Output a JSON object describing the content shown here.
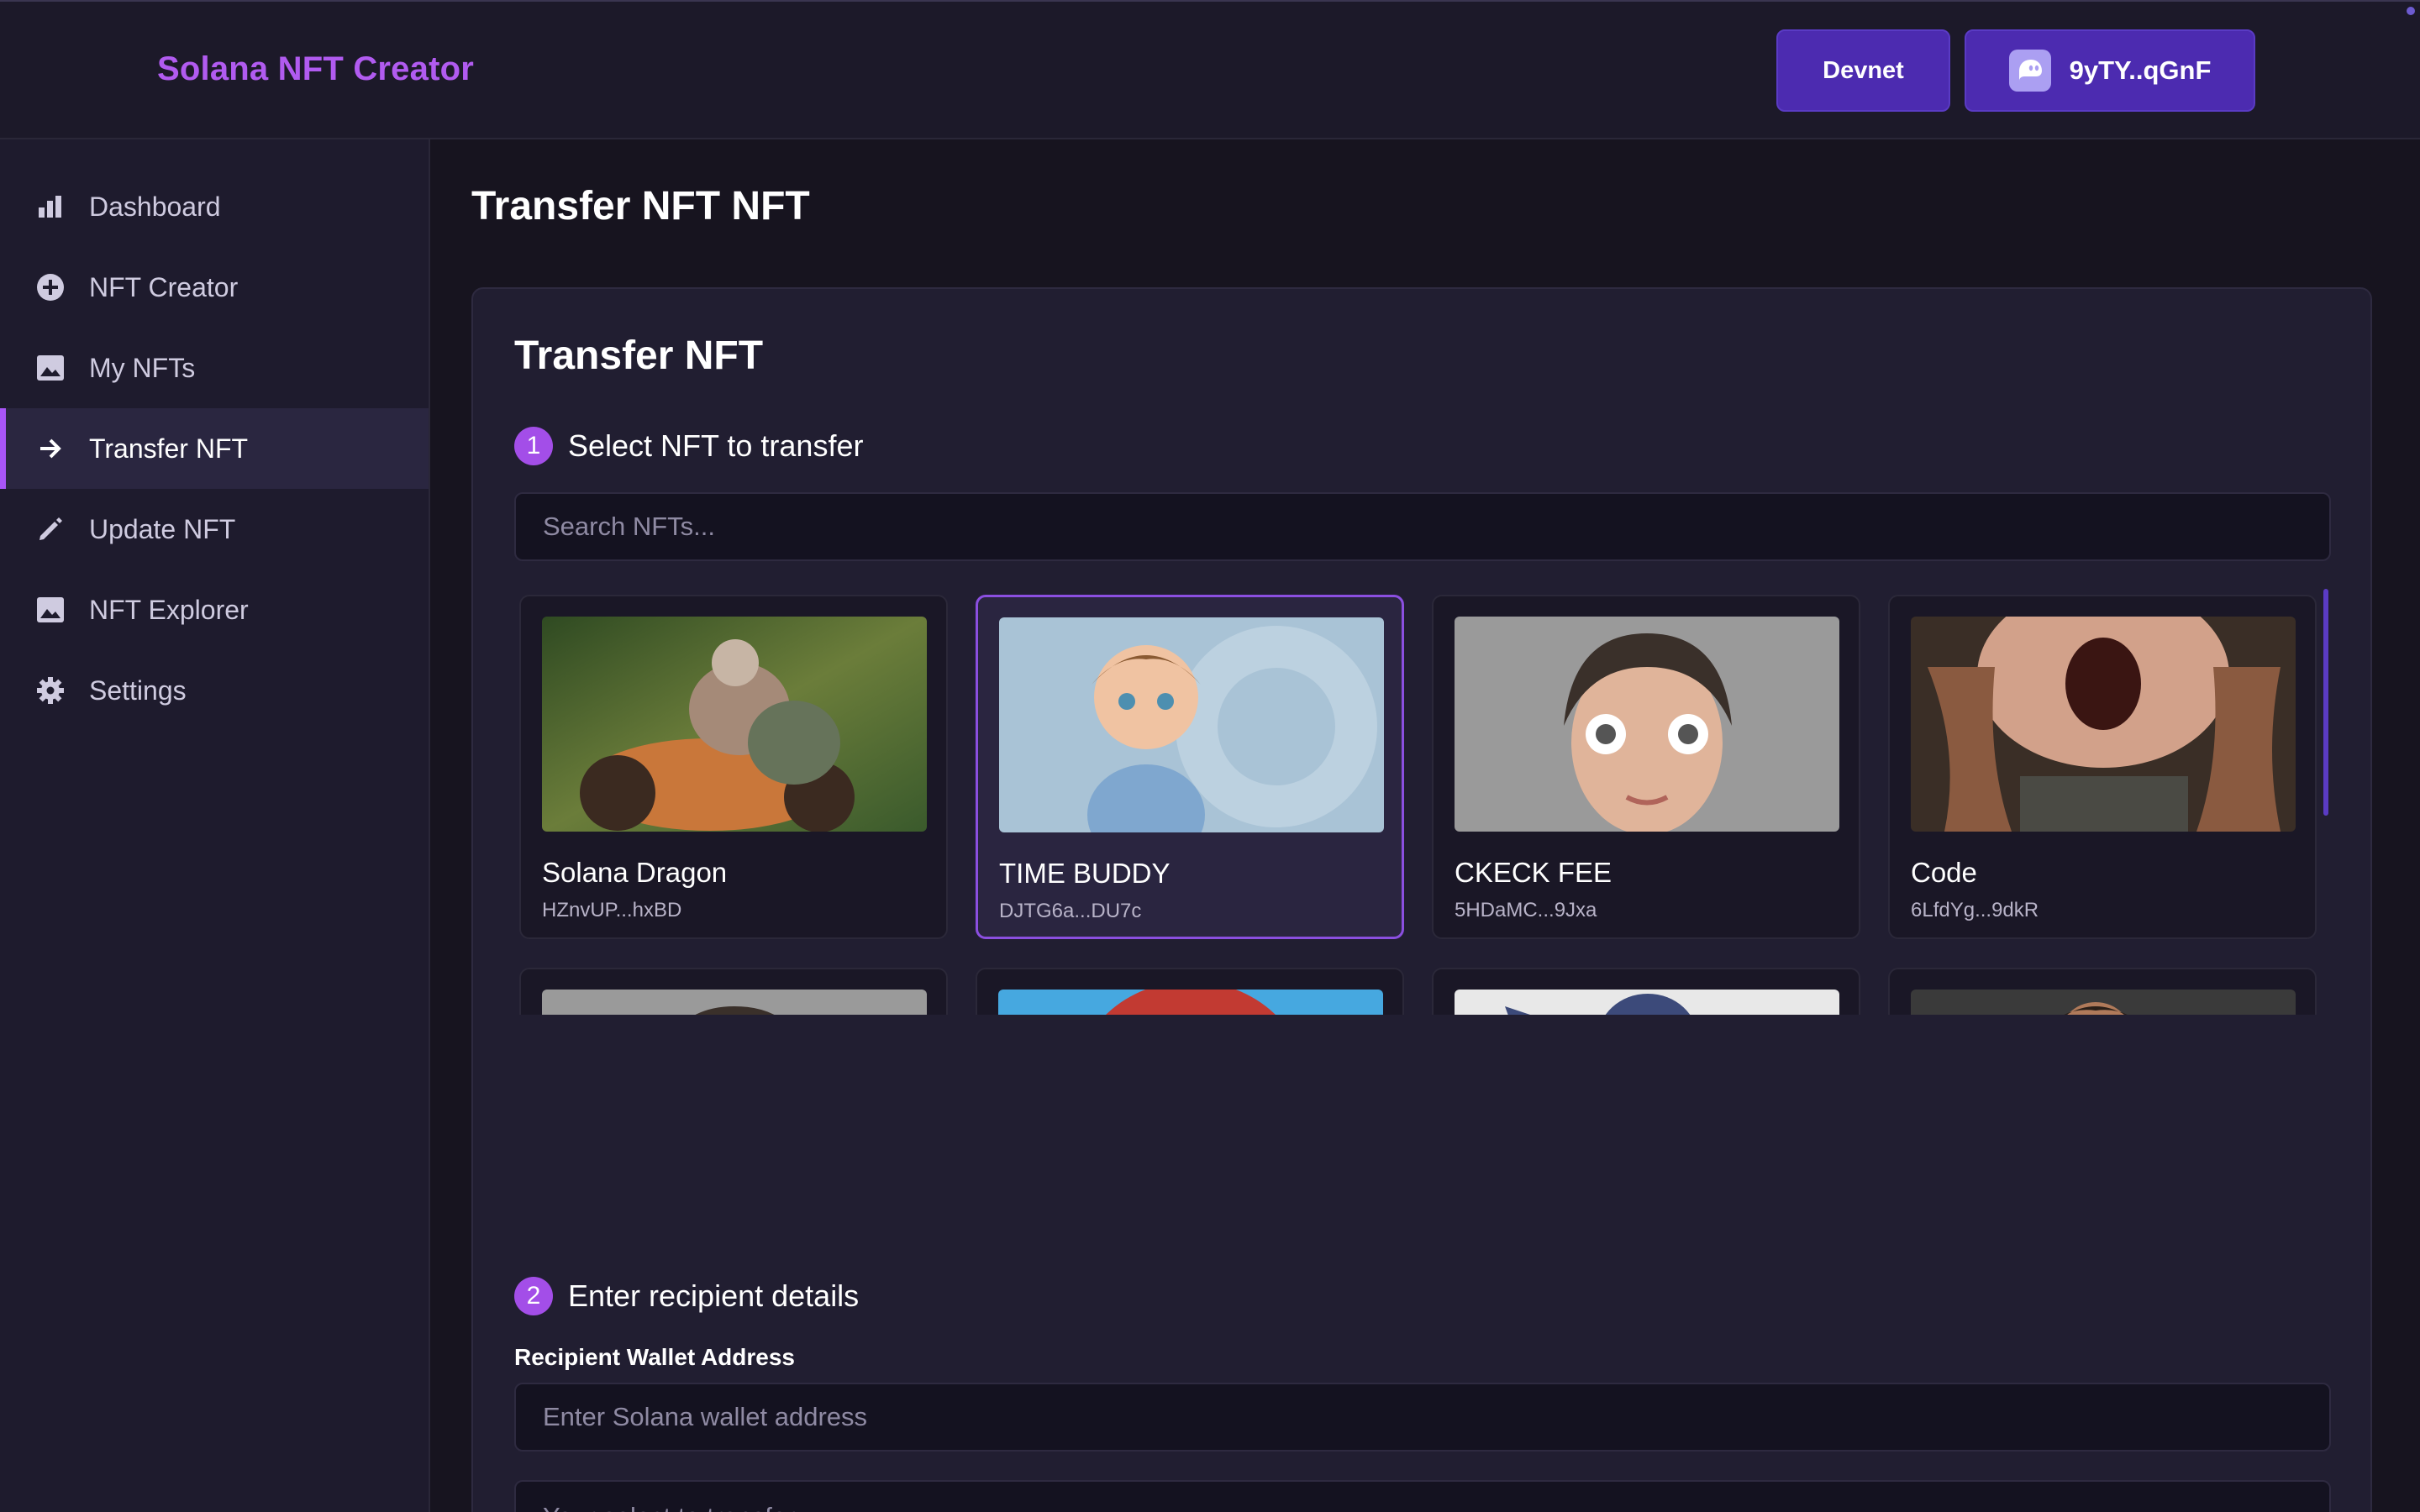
{
  "header": {
    "brand": "Solana NFT Creator",
    "network_label": "Devnet",
    "wallet_label": "9yTY..qGnF",
    "wallet_icon": "phantom-ghost-icon"
  },
  "sidebar": {
    "items": [
      {
        "label": "Dashboard",
        "icon": "bar-chart-icon"
      },
      {
        "label": "NFT Creator",
        "icon": "plus-circle-icon"
      },
      {
        "label": "My NFTs",
        "icon": "image-icon"
      },
      {
        "label": "Transfer NFT",
        "icon": "arrow-right-icon",
        "active": true
      },
      {
        "label": "Update NFT",
        "icon": "pencil-icon"
      },
      {
        "label": "NFT Explorer",
        "icon": "image-icon"
      },
      {
        "label": "Settings",
        "icon": "gear-icon"
      }
    ]
  },
  "main": {
    "page_title": "Transfer NFT NFT",
    "panel_title": "Transfer NFT",
    "step1": {
      "number": "1",
      "label": "Select NFT to transfer"
    },
    "search_placeholder": "Search NFTs...",
    "nfts": [
      {
        "name": "Solana Dragon",
        "address": "HZnvUP...hxBD"
      },
      {
        "name": "TIME BUDDY",
        "address": "DJTG6a...DU7c",
        "selected": true
      },
      {
        "name": "CKECK FEE",
        "address": "5HDaMC...9Jxa"
      },
      {
        "name": "Code",
        "address": "6LfdYg...9dkR"
      }
    ],
    "step2": {
      "number": "2",
      "label": "Enter recipient details"
    },
    "recipient_label": "Recipient Wallet Address",
    "recipient_placeholder": "Enter Solana wallet address",
    "amount_placeholder": "Your select to transfer"
  }
}
